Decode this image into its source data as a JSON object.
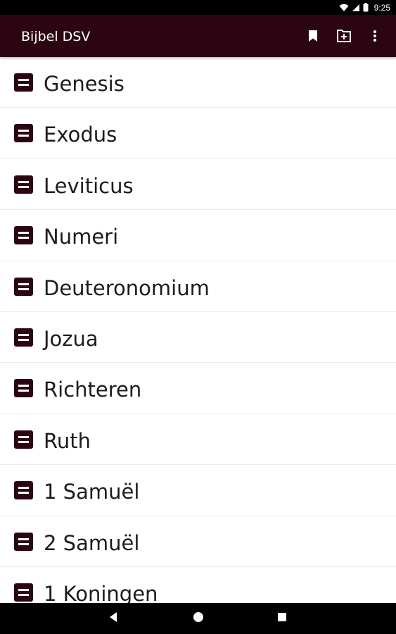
{
  "status_bar": {
    "time": "9:25",
    "icons": [
      "wifi-icon",
      "signal-icon",
      "battery-icon"
    ]
  },
  "app_bar": {
    "title": "Bijbel DSV",
    "background": "#2b0612",
    "actions": [
      "bookmark-icon",
      "add-document-icon",
      "more-vert-icon"
    ]
  },
  "books": [
    {
      "label": "Genesis"
    },
    {
      "label": "Exodus"
    },
    {
      "label": "Leviticus"
    },
    {
      "label": "Numeri"
    },
    {
      "label": "Deuteronomium"
    },
    {
      "label": "Jozua"
    },
    {
      "label": "Richteren"
    },
    {
      "label": "Ruth"
    },
    {
      "label": "1 Samuël"
    },
    {
      "label": "2 Samuël"
    },
    {
      "label": "1 Koningen"
    }
  ],
  "book_icon": "book-list-icon",
  "nav_bar": {
    "buttons": [
      "back-icon",
      "home-icon",
      "recents-icon"
    ]
  }
}
